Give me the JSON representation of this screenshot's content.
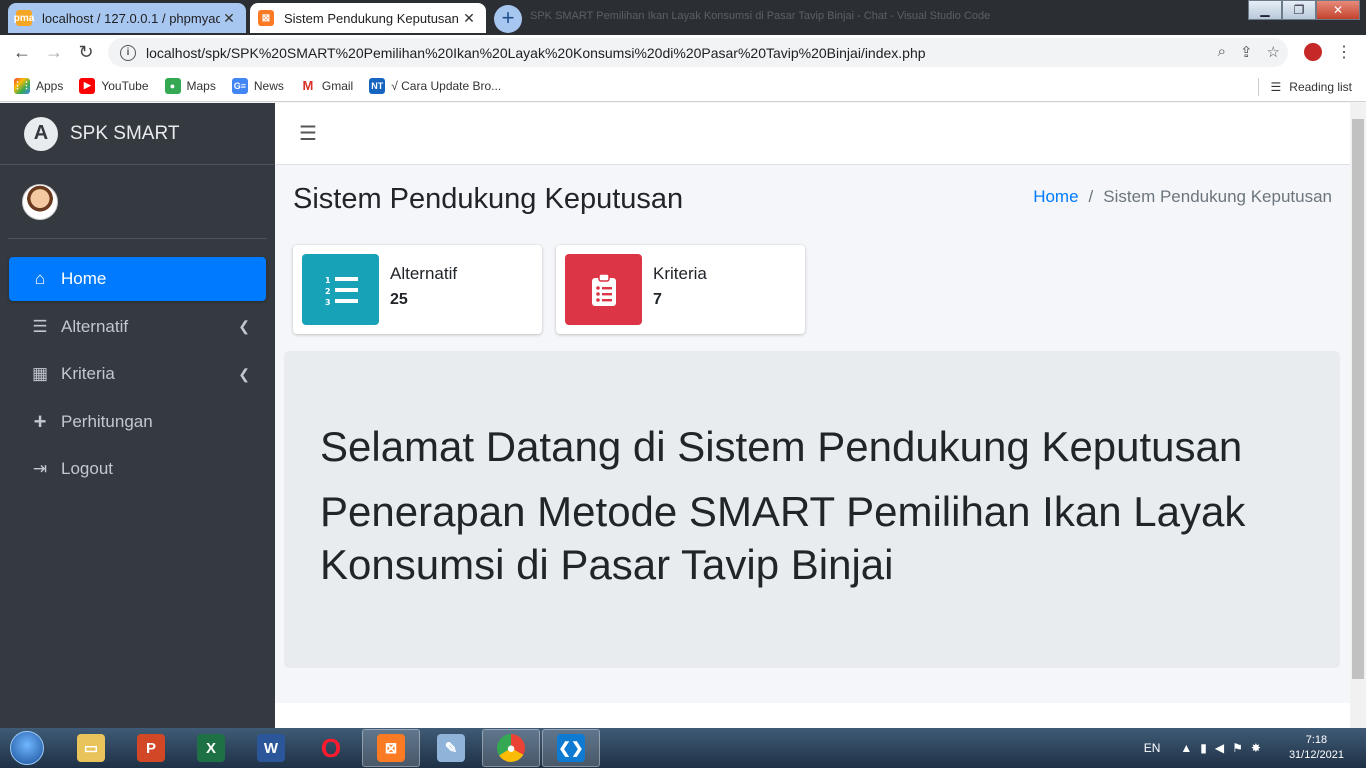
{
  "browser": {
    "tabs": [
      {
        "title": "localhost / 127.0.0.1 / phpmyadm",
        "active": false
      },
      {
        "title": "Sistem Pendukung Keputusan",
        "active": true
      }
    ],
    "background_title": "SPK SMART Pemilihan Ikan Layak Konsumsi di Pasar Tavip Binjai - Chat - Visual Studio Code",
    "url": "localhost/spk/SPK%20SMART%20Pemilihan%20Ikan%20Layak%20Konsumsi%20di%20Pasar%20Tavip%20Binjai/index.php",
    "bookmarks": [
      {
        "label": "Apps",
        "icon": "apps-grid-icon",
        "color": "#ea4335"
      },
      {
        "label": "YouTube",
        "icon": "youtube-icon",
        "color": "#ff0000"
      },
      {
        "label": "Maps",
        "icon": "maps-pin-icon",
        "color": "#34a853"
      },
      {
        "label": "News",
        "icon": "google-news-icon",
        "color": "#4285f4"
      },
      {
        "label": "Gmail",
        "icon": "gmail-icon",
        "color": "#d93025"
      },
      {
        "label": "√ Cara Update Bro...",
        "icon": "bookmark-site-icon",
        "color": "#1565c0"
      }
    ],
    "reading_list": "Reading list"
  },
  "sidebar": {
    "brand": "SPK SMART",
    "brand_logo_letter": "A",
    "items": [
      {
        "label": "Home",
        "icon": "home-icon",
        "active": true,
        "has_chevron": false
      },
      {
        "label": "Alternatif",
        "icon": "list-ol-icon",
        "active": false,
        "has_chevron": true
      },
      {
        "label": "Kriteria",
        "icon": "grid-icon",
        "active": false,
        "has_chevron": true
      },
      {
        "label": "Perhitungan",
        "icon": "plus-icon",
        "active": false,
        "has_chevron": false
      },
      {
        "label": "Logout",
        "icon": "sign-out-icon",
        "active": false,
        "has_chevron": false
      }
    ]
  },
  "page": {
    "title": "Sistem Pendukung Keputusan",
    "breadcrumb": {
      "home": "Home",
      "current": "Sistem Pendukung Keputusan"
    },
    "info_boxes": [
      {
        "label": "Alternatif",
        "value": "25",
        "icon": "list-ol-icon",
        "color": "#17a2b8"
      },
      {
        "label": "Kriteria",
        "value": "7",
        "icon": "clipboard-list-icon",
        "color": "#dc3545"
      }
    ],
    "welcome_line1": "Selamat Datang di Sistem Pendukung Keputusan",
    "welcome_line2": "Penerapan Metode SMART Pemilihan Ikan Layak Konsumsi di Pasar Tavip Binjai"
  },
  "taskbar": {
    "apps": [
      "file-explorer-icon",
      "powerpoint-icon",
      "excel-icon",
      "word-icon",
      "opera-icon",
      "xampp-icon",
      "paint-icon",
      "chrome-icon",
      "vscode-icon"
    ],
    "language": "EN",
    "time": "7:18",
    "date": "31/12/2021"
  },
  "colors": {
    "sidebar_bg": "#343a40",
    "primary": "#007bff",
    "info": "#17a2b8",
    "danger": "#dc3545"
  }
}
